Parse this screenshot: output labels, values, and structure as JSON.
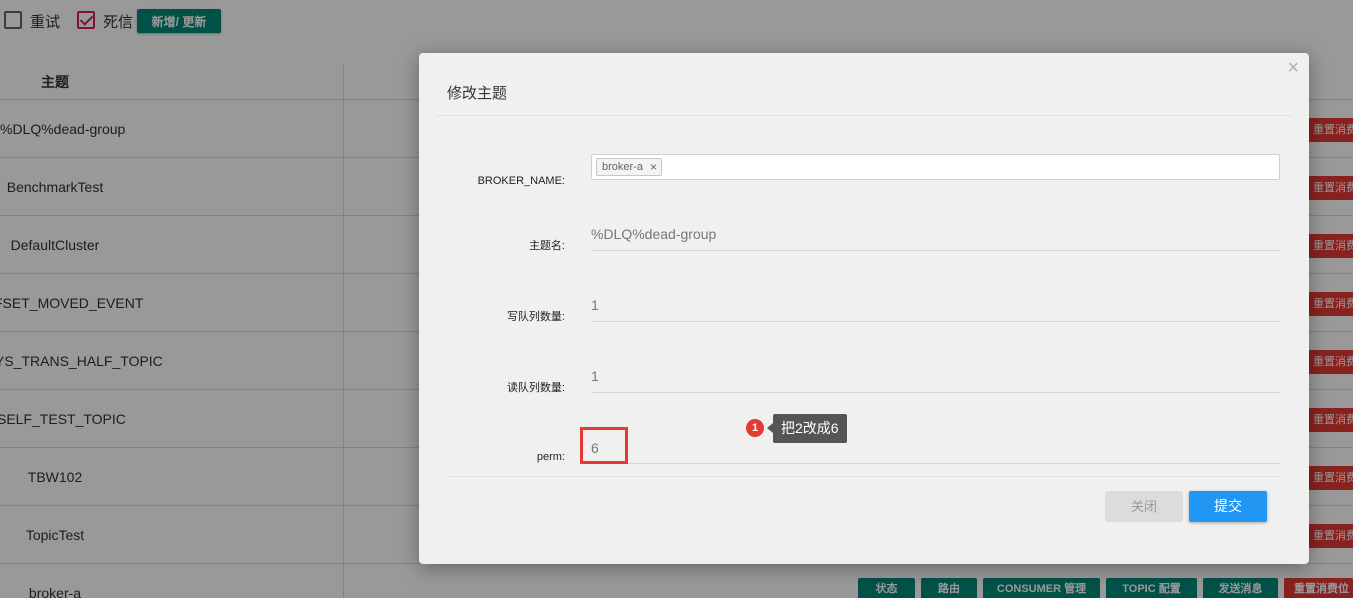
{
  "toolbar": {
    "retry_label": "重试",
    "retry_checked": false,
    "dead_letter_label": "死信",
    "dead_letter_checked": true,
    "add_update_label": "新增/ 更新"
  },
  "table": {
    "topic_header": "主题",
    "rows": [
      {
        "name": "%DLQ%dead-group"
      },
      {
        "name": "BenchmarkTest"
      },
      {
        "name": "DefaultCluster"
      },
      {
        "name": "FSET_MOVED_EVENT"
      },
      {
        "name": "YS_TRANS_HALF_TOPIC"
      },
      {
        "name": "SELF_TEST_TOPIC"
      },
      {
        "name": "TBW102"
      },
      {
        "name": "TopicTest"
      },
      {
        "name": "broker-a"
      }
    ],
    "reset_label": "重置消费位",
    "actions": {
      "status": "状态",
      "route": "路由",
      "consumer": "CONSUMER 管理",
      "topic_config": "TOPIC 配置",
      "send": "发送消息",
      "reset": "重置消费位"
    }
  },
  "modal": {
    "title": "修改主题",
    "close_symbol": "×",
    "broker_name_label": "BROKER_NAME:",
    "broker_tag": "broker-a",
    "broker_tag_remove": "×",
    "topic_name_label": "主题名:",
    "topic_name_value": "%DLQ%dead-group",
    "write_queue_label": "写队列数量:",
    "write_queue_value": "1",
    "read_queue_label": "读队列数量:",
    "read_queue_value": "1",
    "perm_label": "perm:",
    "perm_value": "6",
    "close_button": "关闭",
    "submit_button": "提交"
  },
  "annotation": {
    "number": "1",
    "text": "把2改成6"
  },
  "colors": {
    "accent_green": "#00897b",
    "danger_red": "#e53935",
    "primary_blue": "#2196f3",
    "checkbox_pink": "#d81b60"
  }
}
